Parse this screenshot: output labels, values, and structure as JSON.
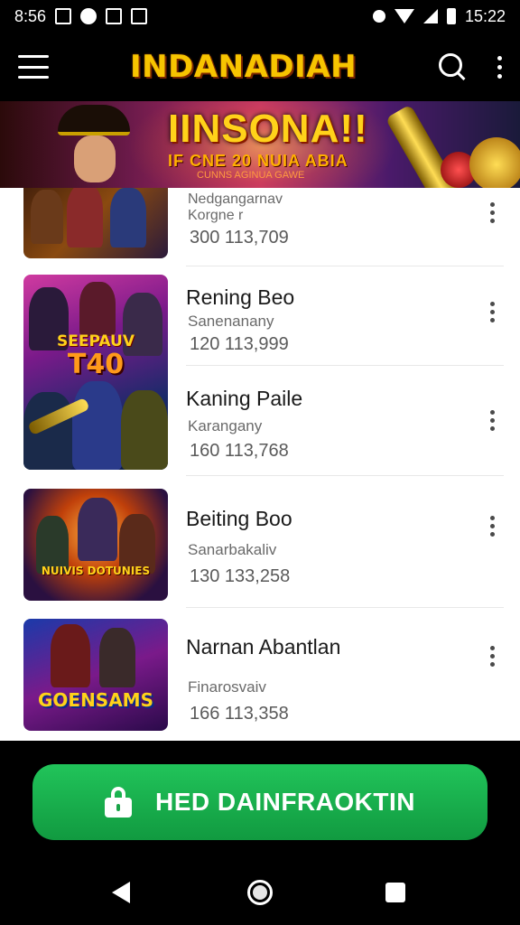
{
  "status_bar": {
    "time_left": "8:56",
    "time_right": "15:22",
    "icons": [
      "mail-icon",
      "notification-icon",
      "media-icon",
      "photo-icon",
      "vibrate-icon",
      "wifi-icon",
      "signal-icon",
      "battery-icon"
    ]
  },
  "app_bar": {
    "title": "INDANADIAH",
    "icons": [
      "menu-icon",
      "search-icon",
      "more-icon"
    ]
  },
  "banner": {
    "title": "IINSONA!!",
    "subtitle": "IF CNE 20 NUIA ABIA",
    "subtitle2": "CUNNS AGINUA GAWE"
  },
  "list": {
    "items": [
      {
        "title": "",
        "subtitle_line1": "Nedgangarnav",
        "subtitle_line2": "Korgne r",
        "count": "300 113,709",
        "thumb_text": ""
      },
      {
        "title": "Rening Beo",
        "subtitle": "Sanenanany",
        "count": "120 113,999",
        "thumb_text": "SEEPAUV",
        "thumb_text2": "T40"
      },
      {
        "title": "Kaning Paile",
        "subtitle": "Karangany",
        "count": "160 113,768",
        "thumb_text": ""
      },
      {
        "title": "Beiting Boo",
        "subtitle": "Sanarbakaliv",
        "count": "130 133,258",
        "thumb_text": "NUIVIS DOTUNIES"
      },
      {
        "title": "Narnan  Abantlan",
        "subtitle": "Finarosvaiv",
        "count": "166 113,358",
        "thumb_text": "GOENSAMS"
      }
    ]
  },
  "cta": {
    "label": "HED DAINFRAOKTIN",
    "color": "#1db954"
  },
  "nav_bar": {
    "icons": [
      "back-icon",
      "home-icon",
      "recents-icon"
    ]
  }
}
